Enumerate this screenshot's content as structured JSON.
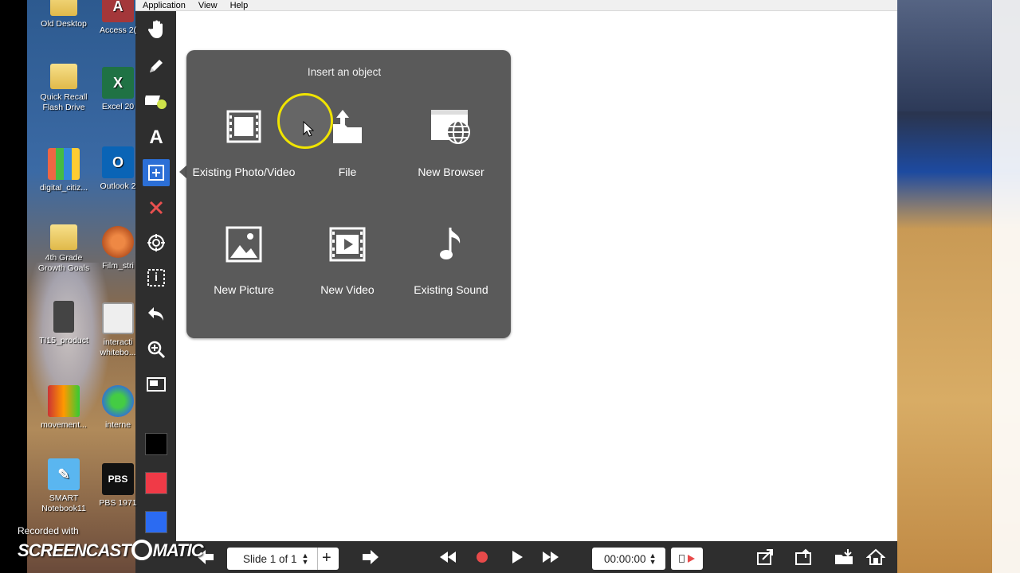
{
  "menu": {
    "application": "Application",
    "view": "View",
    "help": "Help"
  },
  "desktop_icons": [
    {
      "label": "Old Desktop",
      "icon": "folder-icon"
    },
    {
      "label": "Access 2(",
      "icon": "access-icon"
    },
    {
      "label": "Quick Recall Flash Drive",
      "icon": "folder-icon"
    },
    {
      "label": "Excel 20",
      "icon": "excel-icon"
    },
    {
      "label": "digital_citiz...",
      "icon": "tile-icon"
    },
    {
      "label": "Outlook 2",
      "icon": "outlook-icon"
    },
    {
      "label": "4th Grade Growth Goals",
      "icon": "folder-icon"
    },
    {
      "label": "Film_stri",
      "icon": "basketball-icon"
    },
    {
      "label": "TI15_product",
      "icon": "calculator-icon"
    },
    {
      "label": "interacti whitebo...",
      "icon": "whiteboard-icon"
    },
    {
      "label": "movement...",
      "icon": "movement-icon"
    },
    {
      "label": "interne",
      "icon": "globe-icon"
    },
    {
      "label": "SMART Notebook11",
      "icon": "smart-icon"
    },
    {
      "label": "PBS 1971",
      "icon": "pbs-icon"
    }
  ],
  "screencast": {
    "recorded_with": "Recorded with",
    "brand": "SCREENCAST",
    "brand_suffix": "MATIC"
  },
  "toolbar": {
    "tools": [
      "hand-icon",
      "pen-icon",
      "eraser-icon",
      "text-icon",
      "insert-icon",
      "delete-icon",
      "target-icon",
      "select-icon",
      "undo-icon",
      "zoom-icon",
      "screen-icon"
    ],
    "active_tool": "insert-icon",
    "colors": [
      "#000000",
      "#f03a47",
      "#2b6bf2"
    ]
  },
  "popup": {
    "title": "Insert an object",
    "items": [
      {
        "label": "Existing Photo/Video",
        "icon": "film-icon"
      },
      {
        "label": "File",
        "icon": "file-upload-icon"
      },
      {
        "label": "New Browser",
        "icon": "browser-globe-icon"
      },
      {
        "label": "New Picture",
        "icon": "picture-icon"
      },
      {
        "label": "New Video",
        "icon": "video-icon"
      },
      {
        "label": "Existing Sound",
        "icon": "music-note-icon"
      }
    ]
  },
  "bottombar": {
    "slide_label": "Slide 1 of 1",
    "time": "00:00:00"
  }
}
